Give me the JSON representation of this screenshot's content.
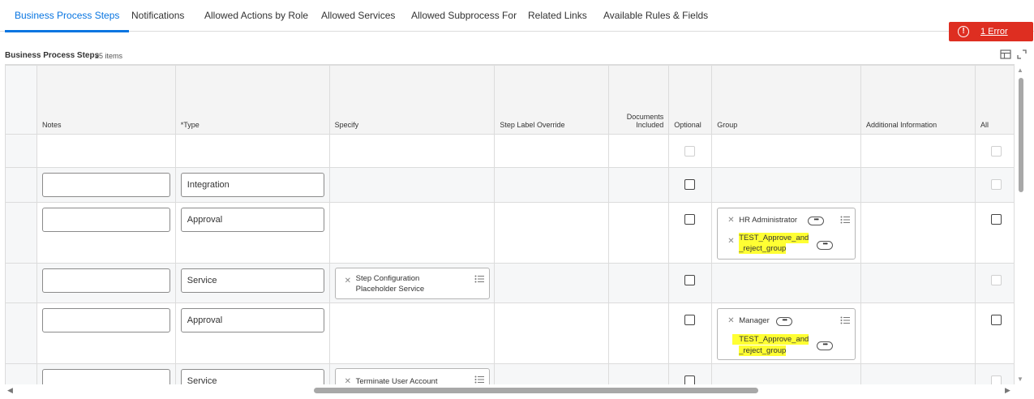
{
  "tabs": [
    {
      "label": "Business Process Steps",
      "active": true
    },
    {
      "label": "Notifications"
    },
    {
      "label": "Allowed Actions by Role"
    },
    {
      "label": "Allowed Services"
    },
    {
      "label": "Allowed Subprocess For"
    },
    {
      "label": "Related Links"
    },
    {
      "label": "Available Rules & Fields"
    }
  ],
  "error": {
    "icon": "!",
    "label": "1 Error",
    "color": "#de2e21"
  },
  "section": {
    "title": "Business Process Steps",
    "count": "25 items"
  },
  "columns": {
    "notes": "Notes",
    "type": "*Type",
    "specify": "Specify",
    "step_label": "Step Label Override",
    "documents": "Documents Included",
    "optional": "Optional",
    "group": "Group",
    "additional": "Additional Information",
    "all": "All"
  },
  "rows": [
    {
      "type": "",
      "specify": [],
      "group": []
    },
    {
      "type": "Integration",
      "specify": [],
      "group": []
    },
    {
      "type": "Approval",
      "specify": [],
      "group": [
        {
          "label": "HR Administrator"
        },
        {
          "label": "TEST_Approve_and _reject_group",
          "highlight": true
        }
      ]
    },
    {
      "type": "Service",
      "specify": [
        {
          "label": "Step Configuration Placeholder Service"
        }
      ],
      "group": []
    },
    {
      "type": "Approval",
      "specify": [],
      "group": [
        {
          "label": "Manager"
        },
        {
          "label": "TEST_Approve_and _reject_group",
          "highlight": true
        }
      ]
    },
    {
      "type": "Service",
      "specify": [
        {
          "label": "Terminate User Account"
        }
      ],
      "group": []
    }
  ],
  "texts": {
    "r2_type": "Integration",
    "r3_type": "Approval",
    "r3_g1": "HR Administrator",
    "r3_g2a": "TEST_Approve_and",
    "r3_g2b": "_reject_group",
    "r4_type": "Service",
    "r4_s1a": "Step Configuration",
    "r4_s1b": "Placeholder Service",
    "r5_type": "Approval",
    "r5_g1": "Manager",
    "r5_g2a": "TEST_Approve_and",
    "r5_g2b": "_reject_group",
    "r6_type": "Service",
    "r6_s1": "Terminate User Account"
  },
  "icons": [
    "table-view-icon",
    "fullscreen-icon",
    "remove-x-icon",
    "more-options-icon",
    "list-prompt-icon",
    "error-icon"
  ],
  "colors": {
    "accent": "#0875e1",
    "highlight": "#ffff33",
    "error": "#de2e21"
  }
}
